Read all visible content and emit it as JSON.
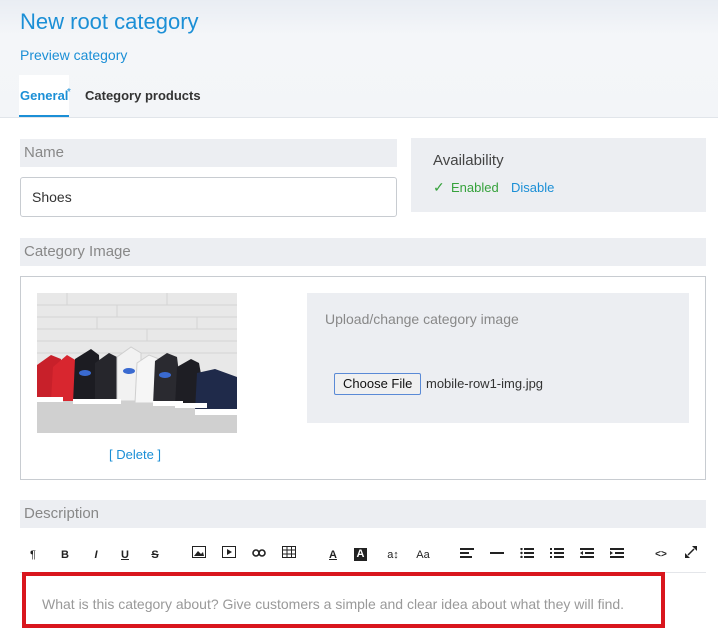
{
  "header": {
    "title": "New root category",
    "preview_link": "Preview category",
    "tabs": [
      {
        "label": "General",
        "marker": "*"
      },
      {
        "label": "Category products"
      }
    ]
  },
  "name": {
    "label": "Name",
    "value": "Shoes"
  },
  "availability": {
    "title": "Availability",
    "enabled_label": "Enabled",
    "disable_label": "Disable"
  },
  "category_image": {
    "label": "Category Image",
    "delete_label": "[ Delete ]",
    "upload_title": "Upload/change category image",
    "choose_file_label": "Choose File",
    "file_name": "mobile-row1-img.jpg"
  },
  "description": {
    "label": "Description",
    "placeholder": "What is this category about? Give customers a simple and clear idea about what they will find.",
    "toolbar": [
      {
        "icon": "paragraph-icon",
        "glyph": "¶"
      },
      {
        "icon": "bold-icon",
        "glyph": "B"
      },
      {
        "icon": "italic-icon",
        "glyph": "I"
      },
      {
        "icon": "underline-icon",
        "glyph": "U"
      },
      {
        "icon": "strikethrough-icon",
        "glyph": "S"
      },
      {
        "icon": "image-icon",
        "glyph": ""
      },
      {
        "icon": "video-icon",
        "glyph": ""
      },
      {
        "icon": "link-icon",
        "glyph": ""
      },
      {
        "icon": "table-icon",
        "glyph": ""
      },
      {
        "icon": "font-color-icon",
        "glyph": "A"
      },
      {
        "icon": "background-color-icon",
        "glyph": "A"
      },
      {
        "icon": "font-size-icon",
        "glyph": "a↕"
      },
      {
        "icon": "font-family-icon",
        "glyph": "Aa"
      },
      {
        "icon": "align-icon",
        "glyph": ""
      },
      {
        "icon": "horizontal-rule-icon",
        "glyph": ""
      },
      {
        "icon": "bullet-list-icon",
        "glyph": ""
      },
      {
        "icon": "numbered-list-icon",
        "glyph": ""
      },
      {
        "icon": "outdent-icon",
        "glyph": ""
      },
      {
        "icon": "indent-icon",
        "glyph": ""
      },
      {
        "icon": "code-view-icon",
        "glyph": "<>"
      },
      {
        "icon": "fullscreen-icon",
        "glyph": ""
      }
    ]
  },
  "colors": {
    "accent": "#1b8fd6",
    "enabled_green": "#36a23c",
    "highlight_red": "#d9161d"
  }
}
